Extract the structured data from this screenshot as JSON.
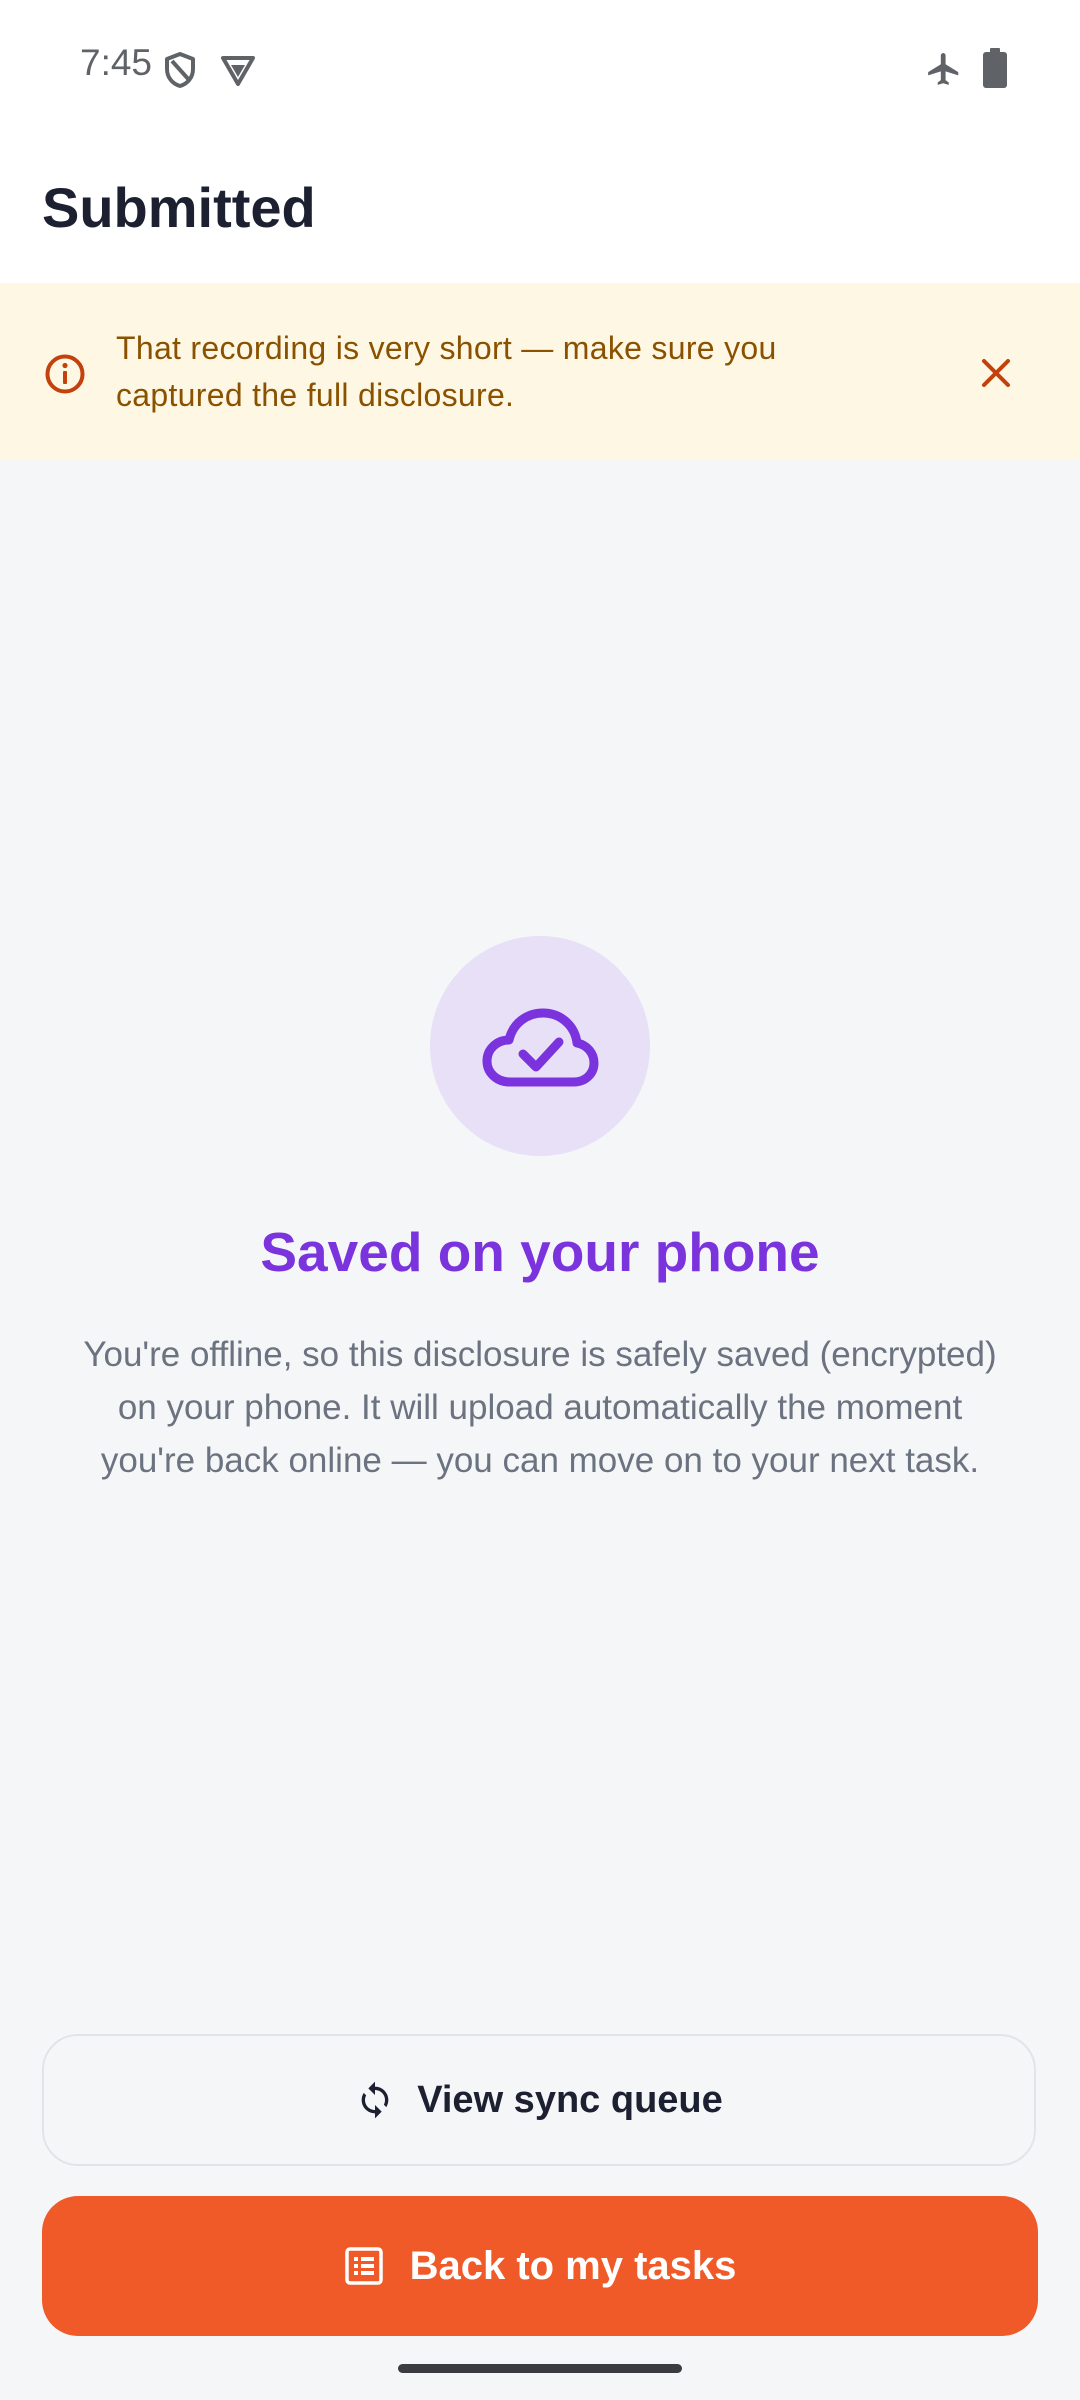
{
  "status_bar": {
    "time": "7:45",
    "icons": [
      "vpn-shield-icon",
      "data-saver-icon",
      "airplane-mode-icon",
      "battery-icon"
    ]
  },
  "app_bar": {
    "title": "Submitted"
  },
  "warning_banner": {
    "icon": "info-circle-icon",
    "message": "That recording is very short — make sure you captured the full disclosure.",
    "close_icon": "close-icon",
    "colors": {
      "background": "#FEF7E4",
      "text": "#8A5200",
      "icon": "#C2410C"
    }
  },
  "status": {
    "icon": "cloud-check-icon",
    "title": "Saved on your phone",
    "body": "You're offline, so this disclosure is safely saved (encrypted) on your phone. It will upload automatically the moment you're back online — you can move on to your next task.",
    "colors": {
      "accent": "#7B34DD",
      "circle": "#E8E0F7"
    }
  },
  "actions": {
    "secondary": {
      "label": "View sync queue",
      "icon": "sync-icon"
    },
    "primary": {
      "label": "Back to my tasks",
      "icon": "list-icon",
      "color": "#F05A28"
    }
  }
}
